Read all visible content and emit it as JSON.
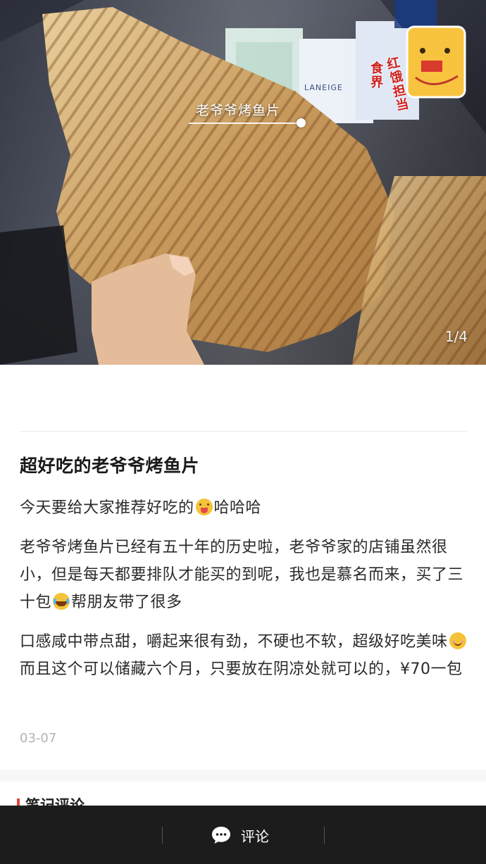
{
  "hero": {
    "tag_label": "老爷爷烤鱼片",
    "counter": "1/4",
    "sticker_lines": [
      "食界",
      "红饿担当"
    ],
    "box_brand": "LANEIGE"
  },
  "post": {
    "title": "超好吃的老爷爷烤鱼片",
    "p1": {
      "before": "今天要给大家推荐好吃的",
      "emoji": "tongue-emoji",
      "after": "哈哈哈"
    },
    "p2": {
      "before": "老爷爷烤鱼片已经有五十年的历史啦，老爷爷家的店铺虽然很小，但是每天都要排队才能买的到呢，我也是慕名而来，买了三十包",
      "emoji": "laughing-tears-emoji",
      "after": "帮朋友带了很多"
    },
    "p3": {
      "before": "口感咸中带点甜，嚼起来很有劲，不硬也不软，超级好吃美味",
      "emoji": "smile-emoji",
      "after": "而且这个可以储藏六个月，只要放在阴凉处就可以的，¥70一包"
    },
    "date": "03-07"
  },
  "comments": {
    "title": "笔记评论"
  },
  "bottom_bar": {
    "comment_label": "评论",
    "icon": "chat-bubble-icon"
  },
  "colors": {
    "accent": "#e0443a",
    "bottom_bar_bg": "#1c1c1c"
  }
}
